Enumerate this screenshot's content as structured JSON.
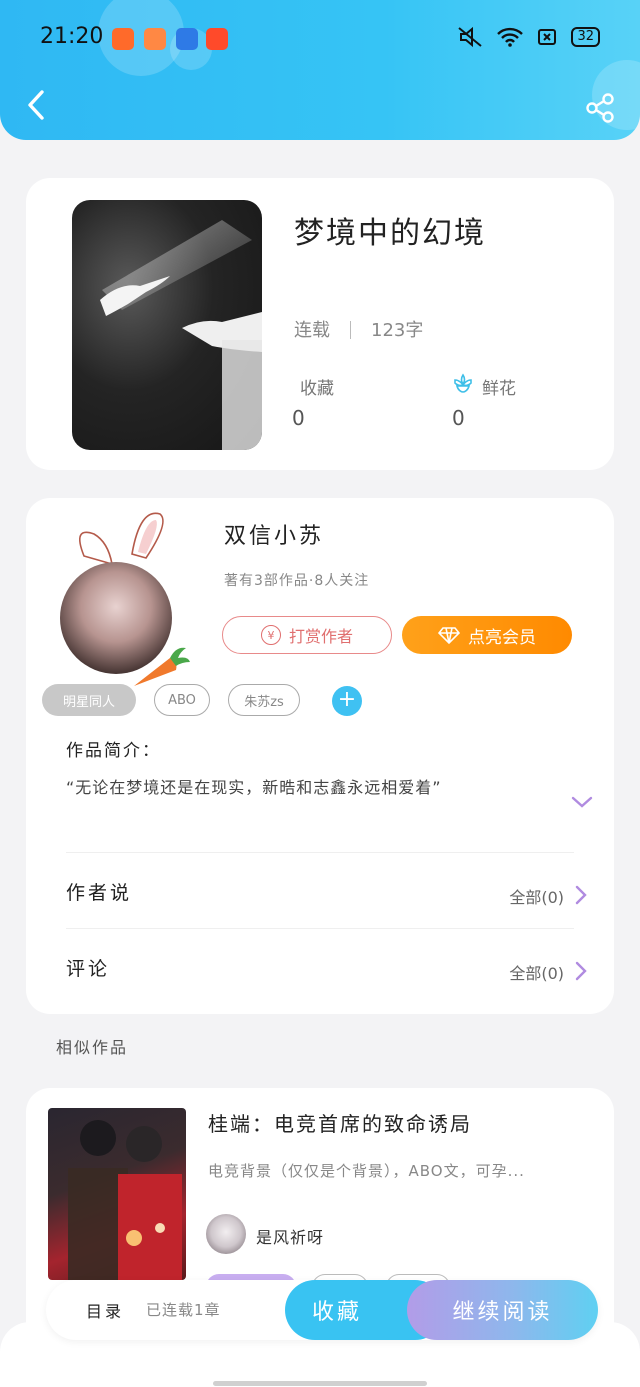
{
  "status_bar": {
    "time": "21:20",
    "battery": "32"
  },
  "book": {
    "title": "梦境中的幻境",
    "status": "连载",
    "word_count": "123字",
    "favorites_label": "收藏",
    "favorites_count": "0",
    "flowers_label": "鲜花",
    "flowers_count": "0"
  },
  "author": {
    "name": "双信小苏",
    "info": "著有3部作品·8人关注",
    "tip_button": "打赏作者",
    "tip_coin": "¥",
    "vip_button": "点亮会员"
  },
  "tags": [
    "明星同人",
    "ABO",
    "朱苏zs"
  ],
  "add_tag": "+",
  "intro": {
    "label": "作品简介：",
    "text": "“无论在梦境还是在现实，新晧和志鑫永远相爱着”"
  },
  "rows": {
    "author_says": {
      "label": "作者说",
      "right": "全部(0)"
    },
    "comments": {
      "label": "评论",
      "right": "全部(0)"
    }
  },
  "similar": {
    "section_title": "相似作品",
    "title": "桂端：电竞首席的致命诱局",
    "desc": "电竞背景（仅仅是个背景），ABO文，可孕...",
    "author": "是风祈呀"
  },
  "bottom": {
    "toc": "目录",
    "toc_status": "已连载1章",
    "favorite_button": "收藏",
    "read_button": "继续阅读"
  },
  "colors": {
    "header": "#36c4f5",
    "vip": "#ff9a0a",
    "tip": "#e06f6f",
    "accent_purple": "#b08be0"
  }
}
